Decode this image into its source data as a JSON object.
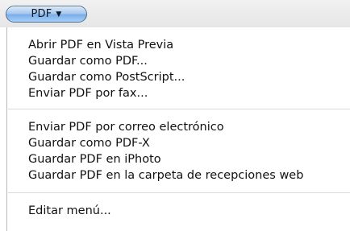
{
  "button": {
    "label": "PDF"
  },
  "menu": {
    "groups": [
      {
        "items": [
          "Abrir PDF en Vista Previa",
          "Guardar como PDF...",
          "Guardar como PostScript...",
          "Enviar PDF por fax..."
        ]
      },
      {
        "items": [
          "Enviar PDF por correo electrónico",
          "Guardar como PDF-X",
          "Guardar PDF en iPhoto",
          "Guardar PDF en la carpeta de recepciones web"
        ]
      },
      {
        "items": [
          "Editar menú..."
        ]
      }
    ]
  }
}
